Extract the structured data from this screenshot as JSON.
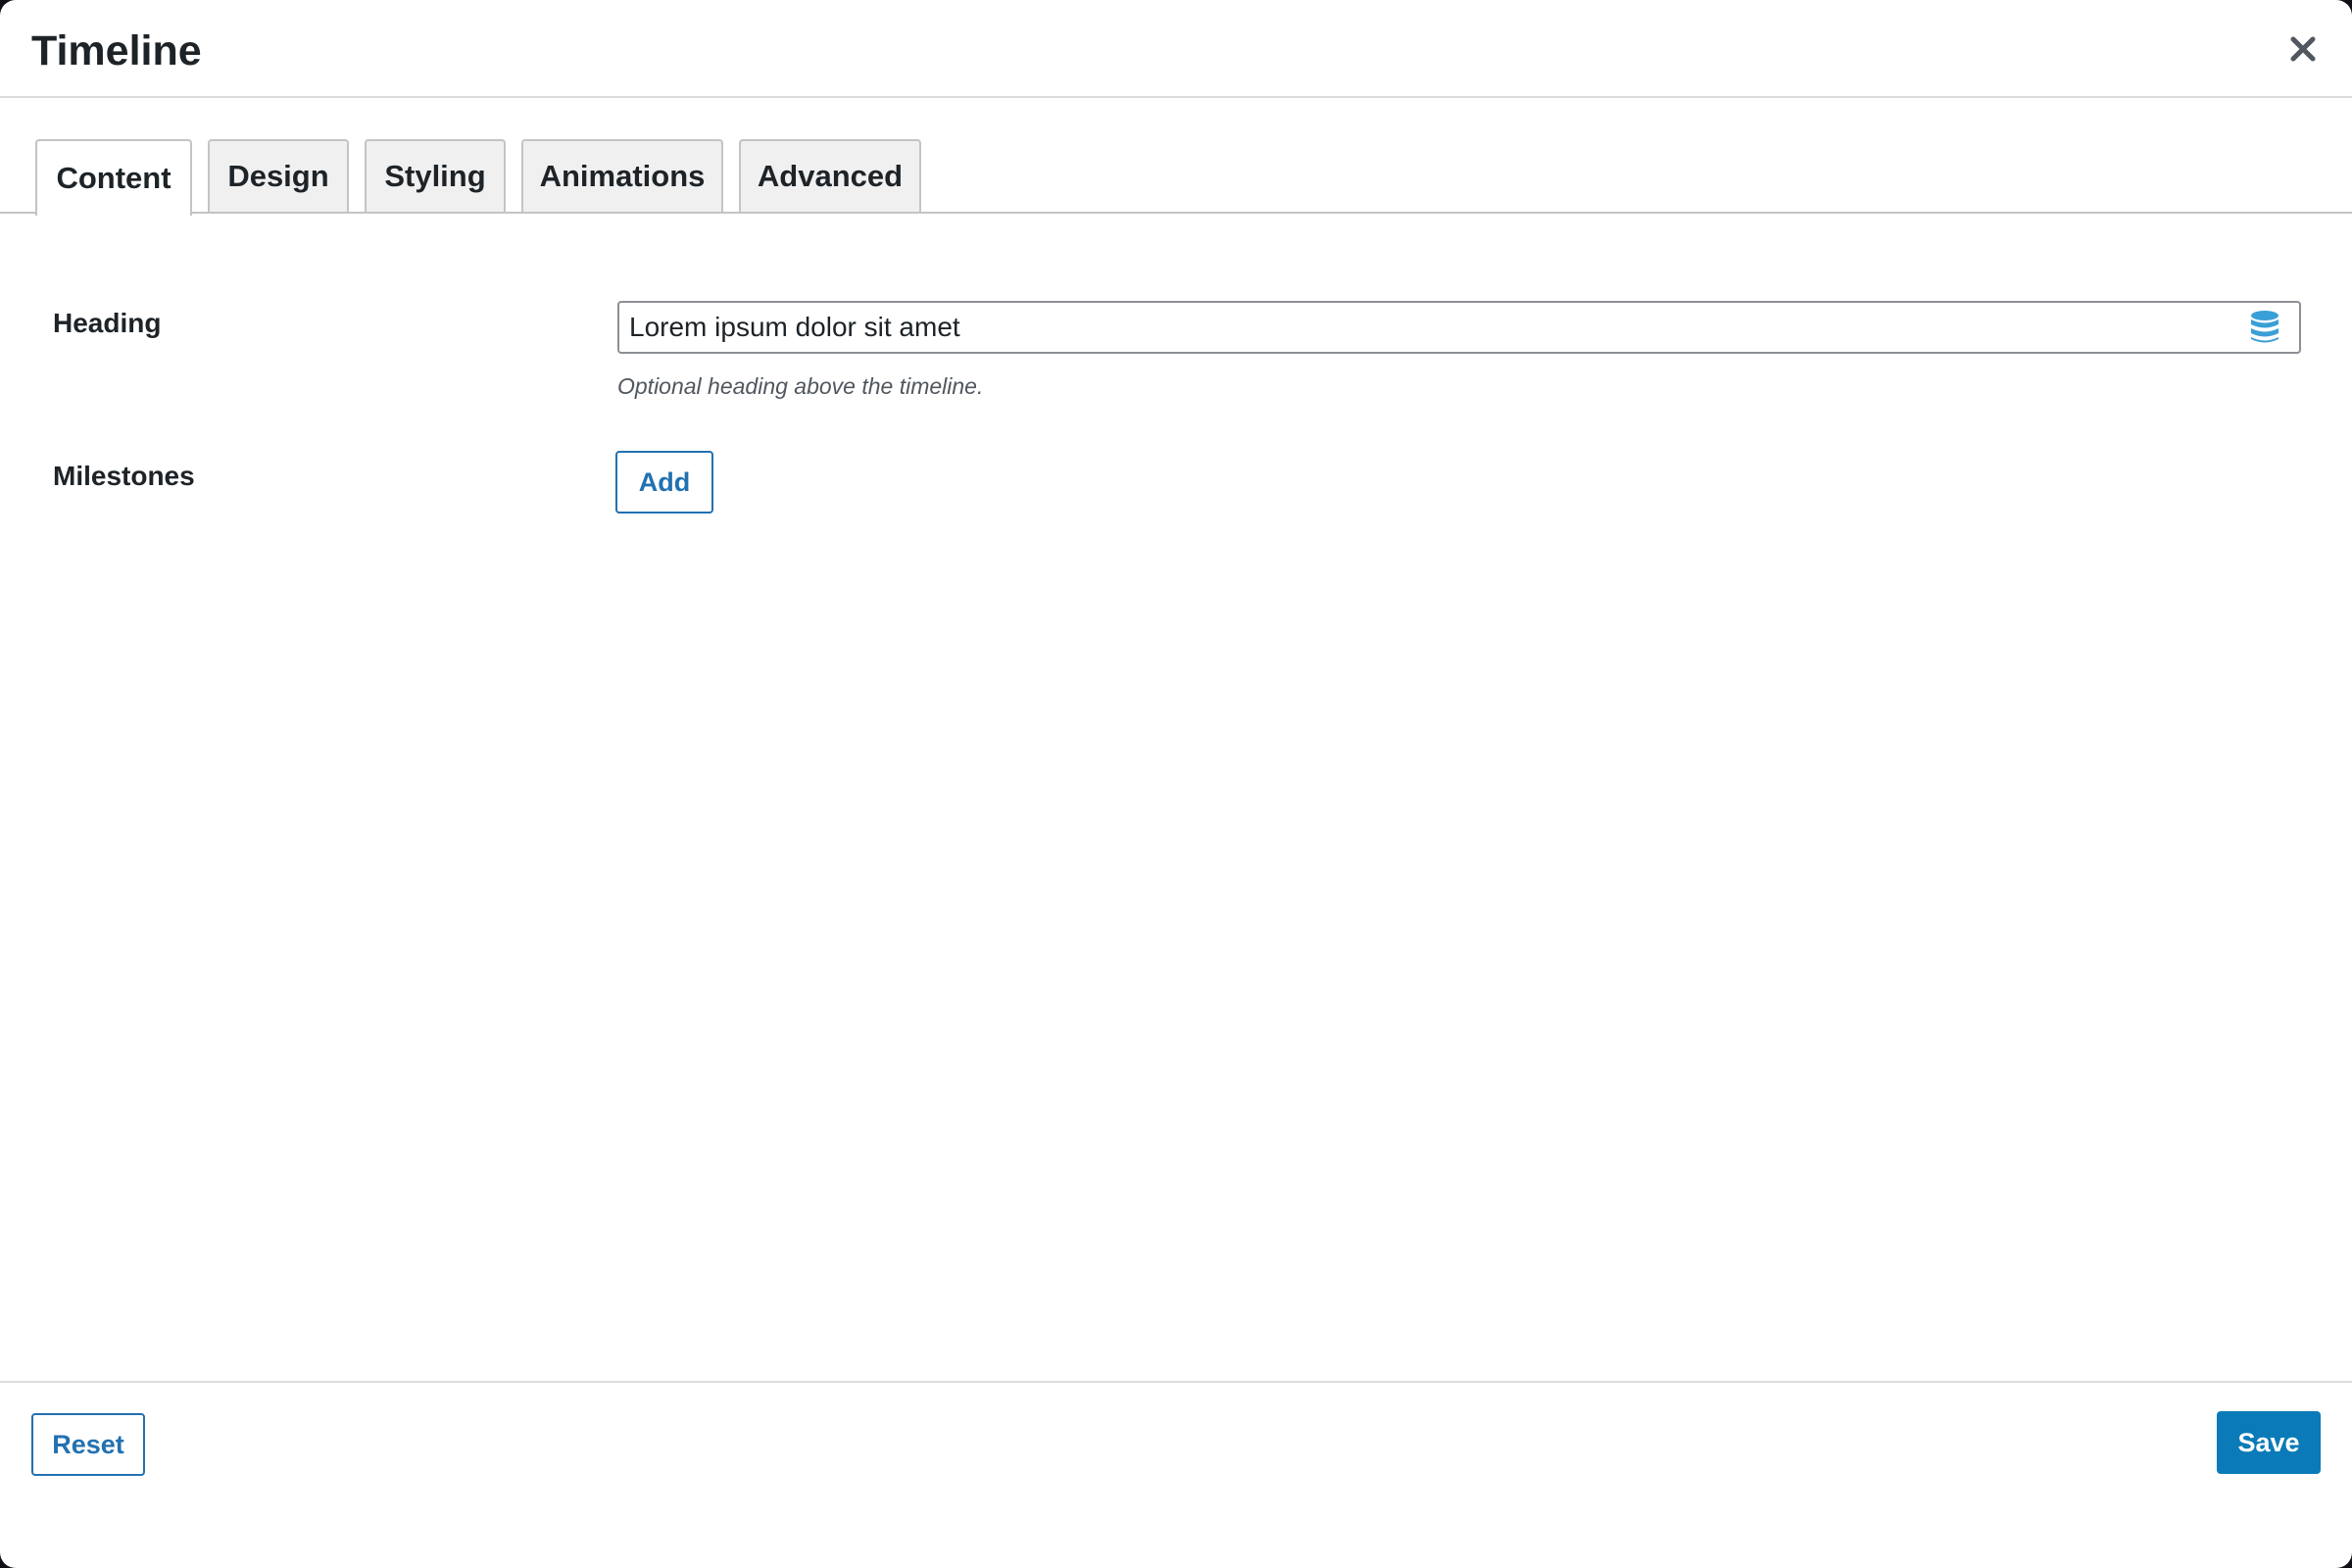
{
  "dialog": {
    "title": "Timeline",
    "close_icon": "close-icon"
  },
  "tabs": [
    {
      "label": "Content",
      "active": true
    },
    {
      "label": "Design",
      "active": false
    },
    {
      "label": "Styling",
      "active": false
    },
    {
      "label": "Animations",
      "active": false
    },
    {
      "label": "Advanced",
      "active": false
    }
  ],
  "fields": {
    "heading": {
      "label": "Heading",
      "value": "Lorem ipsum dolor sit amet",
      "help": "Optional heading above the timeline.",
      "icon": "database-icon"
    },
    "milestones": {
      "label": "Milestones",
      "add_label": "Add"
    }
  },
  "footer": {
    "reset_label": "Reset",
    "save_label": "Save"
  },
  "colors": {
    "accent": "#2271b1",
    "primary_button": "#0a7ab8",
    "database_icon": "#3a9fd6"
  }
}
